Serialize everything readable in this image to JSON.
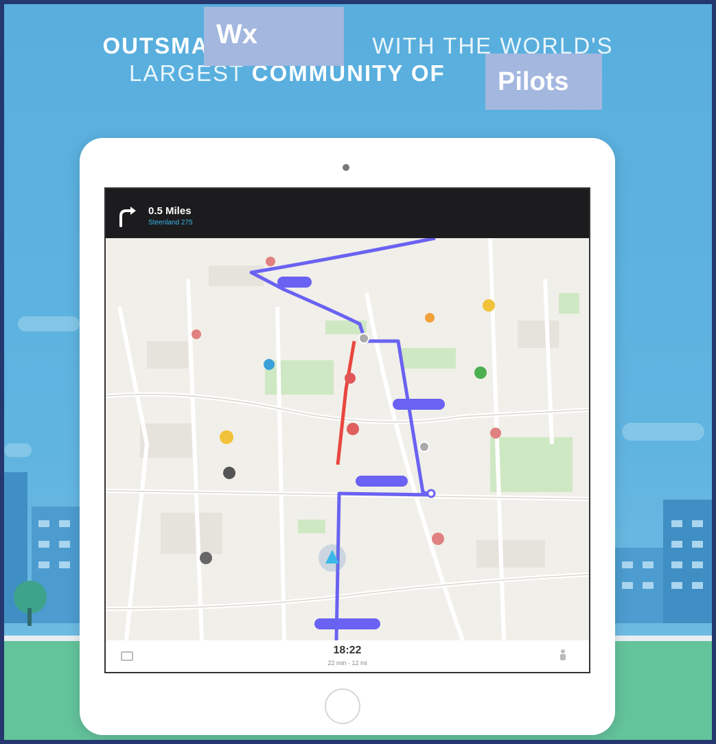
{
  "overlays": {
    "wx": "Wx",
    "pilots": "Pilots"
  },
  "navigation": {
    "distance": "0.5 Miles",
    "street": "Steenland 275"
  },
  "eta": {
    "time": "18:22",
    "details": "22 min · 12 mi"
  },
  "icons": {
    "turn": "turn-right-arrow",
    "menu": "menu-icon",
    "profile": "person-icon",
    "report": "orange-report-button"
  },
  "colors": {
    "sky": "#5fb3df",
    "route": "#6a62f2",
    "traffic": "#e8483f",
    "ground": "#63c39b",
    "header": "#1c1c1e"
  }
}
